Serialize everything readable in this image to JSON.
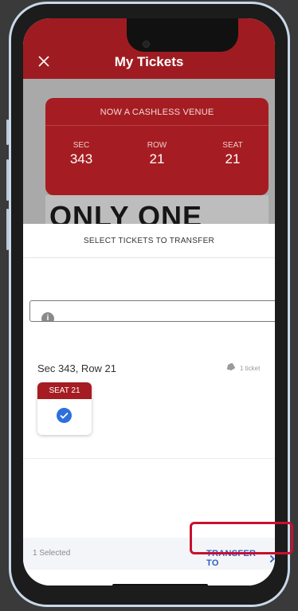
{
  "nav": {
    "title": "My Tickets",
    "close_icon": "close-icon"
  },
  "ticket": {
    "notice": "NOW A CASHLESS VENUE",
    "sec_label": "SEC",
    "sec_value": "343",
    "row_label": "ROW",
    "row_value": "21",
    "seat_label": "SEAT",
    "seat_value": "21",
    "promo_text": "ONLY ONE"
  },
  "sheet": {
    "title": "SELECT TICKETS TO TRANSFER",
    "info_icon_glyph": "i",
    "section_label": "Sec 343, Row 21",
    "ticket_count": "1 ticket",
    "seat_tile_label": "SEAT 21",
    "seat_selected": true
  },
  "footer": {
    "selected_text": "1 Selected",
    "transfer_label": "TRANSFER TO",
    "transfer_icon": "chevron-right-icon"
  },
  "colors": {
    "brand_red": "#a51d22",
    "accent_blue": "#2d5dc8",
    "highlight_red": "#c8102e"
  }
}
